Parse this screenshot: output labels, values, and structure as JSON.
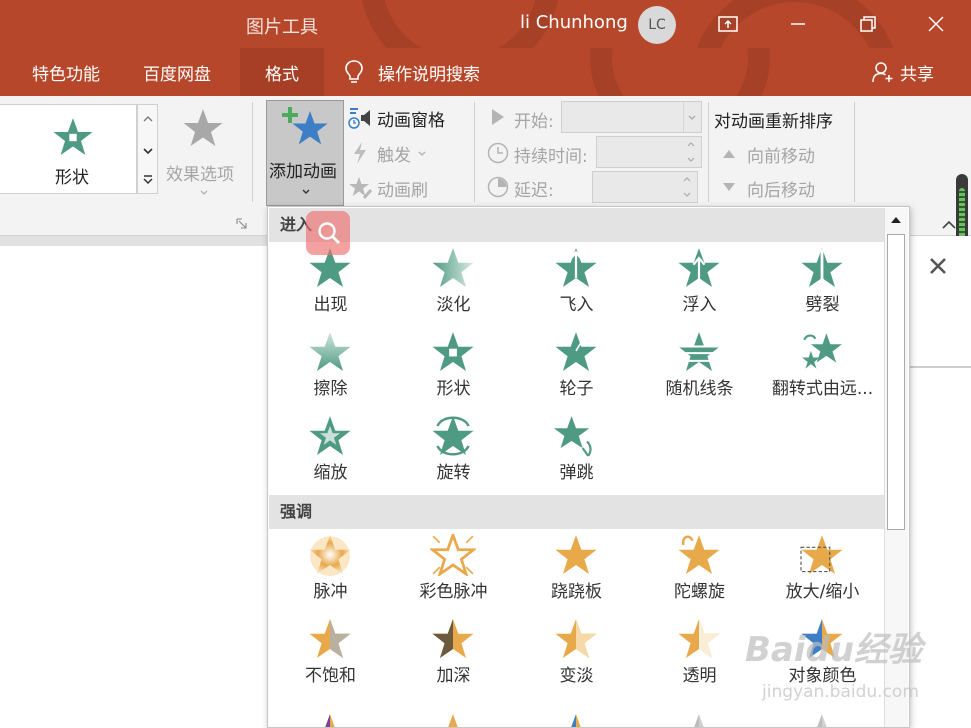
{
  "titlebar": {
    "tool_title": "图片工具",
    "user_name": "li Chunhong",
    "avatar_initials": "LC"
  },
  "tabs": [
    {
      "label": "特色功能"
    },
    {
      "label": "百度网盘"
    },
    {
      "label": "格式"
    },
    {
      "label": "操作说明搜索"
    }
  ],
  "share_label": "共享",
  "ribbon": {
    "shape_label": "形状",
    "effect_options_label": "效果选项",
    "add_animation_label": "添加动画",
    "animation_pane_label": "动画窗格",
    "trigger_label": "触发",
    "animation_painter_label": "动画刷",
    "start_label": "开始:",
    "duration_label": "持续时间:",
    "delay_label": "延迟:",
    "reorder_title": "对动画重新排序",
    "move_earlier_label": "向前移动",
    "move_later_label": "向后移动"
  },
  "gallery": {
    "sections": [
      {
        "title": "进入",
        "items": [
          {
            "label": "出现",
            "icon": "star-appear-icon"
          },
          {
            "label": "淡化",
            "icon": "star-fade-icon"
          },
          {
            "label": "飞入",
            "icon": "star-fly-in-icon"
          },
          {
            "label": "浮入",
            "icon": "star-float-in-icon"
          },
          {
            "label": "劈裂",
            "icon": "star-split-icon"
          },
          {
            "label": "擦除",
            "icon": "star-wipe-icon"
          },
          {
            "label": "形状",
            "icon": "star-shape-icon"
          },
          {
            "label": "轮子",
            "icon": "star-wheel-icon"
          },
          {
            "label": "随机线条",
            "icon": "star-random-bars-icon"
          },
          {
            "label": "翻转式由远...",
            "icon": "star-grow-turn-icon"
          },
          {
            "label": "缩放",
            "icon": "star-zoom-icon"
          },
          {
            "label": "旋转",
            "icon": "star-swivel-icon"
          },
          {
            "label": "弹跳",
            "icon": "star-bounce-icon"
          }
        ]
      },
      {
        "title": "强调",
        "items": [
          {
            "label": "脉冲",
            "icon": "star-pulse-icon"
          },
          {
            "label": "彩色脉冲",
            "icon": "star-color-pulse-icon"
          },
          {
            "label": "跷跷板",
            "icon": "star-teeter-icon"
          },
          {
            "label": "陀螺旋",
            "icon": "star-spin-icon"
          },
          {
            "label": "放大/缩小",
            "icon": "star-grow-shrink-icon"
          },
          {
            "label": "不饱和",
            "icon": "star-desaturate-icon"
          },
          {
            "label": "加深",
            "icon": "star-darken-icon"
          },
          {
            "label": "变淡",
            "icon": "star-lighten-icon"
          },
          {
            "label": "透明",
            "icon": "star-transparency-icon"
          },
          {
            "label": "对象颜色",
            "icon": "star-object-color-icon"
          }
        ]
      }
    ]
  },
  "watermark": {
    "text": "Baidu经验",
    "url": "jingyan.baidu.com"
  },
  "colors": {
    "title_bar": "#b7472a",
    "entrance_star": "#4f9a82",
    "emphasis_star": "#e8a94a",
    "ribbon_bg": "#f3f3f3"
  }
}
